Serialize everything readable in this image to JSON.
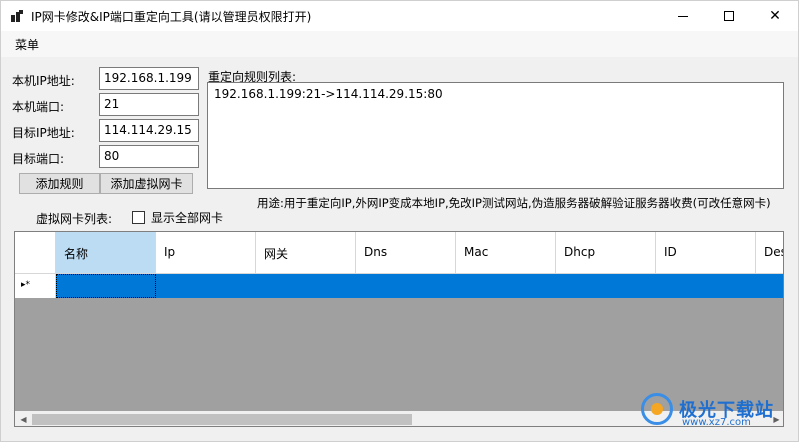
{
  "window": {
    "title": "IP网卡修改&IP端口重定向工具(请以管理员权限打开)",
    "close_glyph": "✕"
  },
  "menu": {
    "label": "菜单"
  },
  "form": {
    "local_ip_label": "本机IP地址:",
    "local_ip_value": "192.168.1.199",
    "local_port_label": "本机端口:",
    "local_port_value": "21",
    "target_ip_label": "目标IP地址:",
    "target_ip_value": "114.114.29.15",
    "target_port_label": "目标端口:",
    "target_port_value": "80",
    "add_rule_button": "添加规则",
    "add_virtual_nic_button": "添加虚拟网卡"
  },
  "rules": {
    "label": "重定向规则列表:",
    "items": [
      "192.168.1.199:21->114.114.29.15:80"
    ]
  },
  "usage_text": "用途:用于重定向IP,外网IP变成本地IP,免改IP测试网站,伪造服务器破解验证服务器收费(可改任意网卡)",
  "virtual_nics": {
    "label": "虚拟网卡列表:",
    "show_all_label": "显示全部网卡",
    "show_all_checked": false
  },
  "grid": {
    "columns": [
      "名称",
      "Ip",
      "网关",
      "Dns",
      "Mac",
      "Dhcp",
      "ID",
      "Des"
    ],
    "new_row_marker": "▸*"
  },
  "watermark": {
    "main": "极光下载站",
    "sub": "www.xz7.com"
  }
}
